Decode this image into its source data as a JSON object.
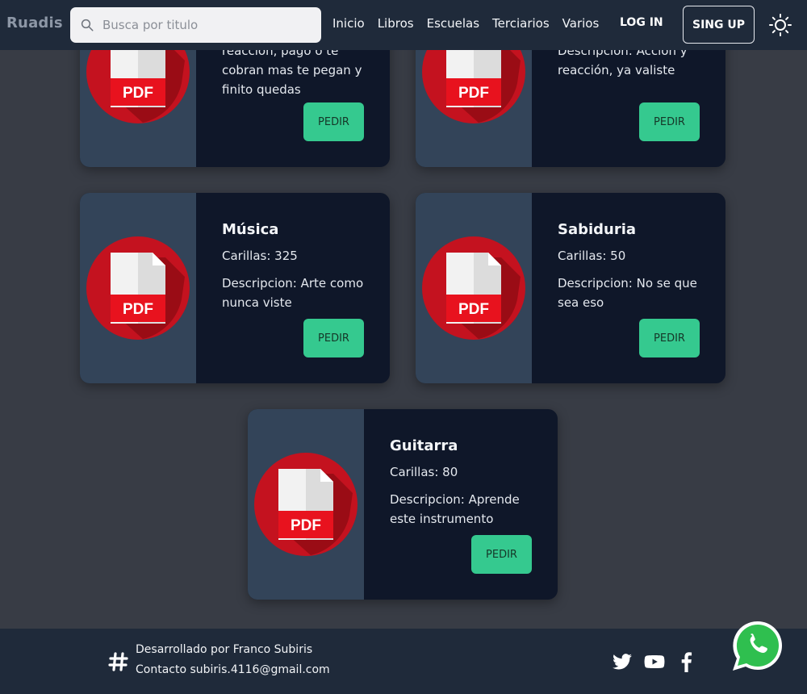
{
  "navbar": {
    "brand": "Ruadis",
    "search_placeholder": "Busca por titulo",
    "links": [
      "Inicio",
      "Libros",
      "Escuelas",
      "Terciarios",
      "Varios"
    ],
    "login": "LOG IN",
    "signup": "SING UP"
  },
  "cards": [
    {
      "title": "",
      "pages": "",
      "desc": "reacción, pago o te cobran mas te pegan y finito quedas",
      "button": "PEDIR",
      "icon_label": "PDF"
    },
    {
      "title": "",
      "pages": "",
      "desc": "Descripcion: Acción y reacción, ya valiste",
      "button": "PEDIR",
      "icon_label": "PDF"
    },
    {
      "title": "Música",
      "pages": "Carillas: 325",
      "desc": "Descripcion: Arte como nunca viste",
      "button": "PEDIR",
      "icon_label": "PDF"
    },
    {
      "title": "Sabiduria",
      "pages": "Carillas: 50",
      "desc": "Descripcion: No se que sea eso",
      "button": "PEDIR",
      "icon_label": "PDF"
    },
    {
      "title": "Guitarra",
      "pages": "Carillas: 80",
      "desc": "Descripcion: Aprende este instrumento",
      "button": "PEDIR",
      "icon_label": "PDF"
    }
  ],
  "footer": {
    "developed_by": "Desarrollado por Franco Subiris",
    "contact": "Contacto subiris.4116@gmail.com"
  },
  "colors": {
    "background": "#383c45",
    "navbar": "#1f2a3a",
    "card_body": "#0f1729",
    "card_thumb": "#334459",
    "button": "#35c98f",
    "pdf_red": "#c4121f"
  },
  "icons": [
    "search-icon",
    "sun-icon",
    "pdf-icon",
    "hash-icon",
    "twitter-icon",
    "youtube-icon",
    "facebook-icon",
    "whatsapp-icon"
  ]
}
